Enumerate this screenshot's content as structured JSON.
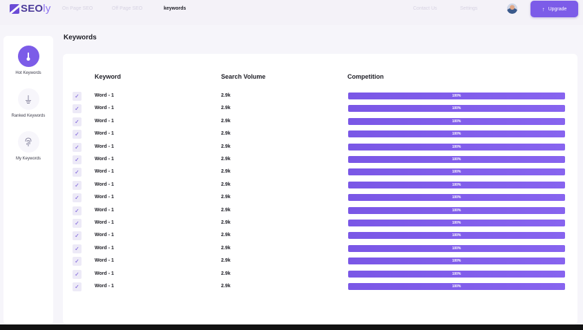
{
  "app": {
    "logo_main": "SEO",
    "logo_accent": "ly",
    "accent_color": "#7c5ce8"
  },
  "nav": {
    "links": [
      {
        "label": "On Page SEO",
        "active": false
      },
      {
        "label": "Off Page SEO",
        "active": false
      },
      {
        "label": "keywords",
        "active": true
      },
      {
        "label": "Contact Us",
        "active": false
      },
      {
        "label": "Settings",
        "active": false
      }
    ],
    "upgrade_label": "Upgrade",
    "upgrade_icon": "arrow-up-icon",
    "avatar_icon": "user-avatar"
  },
  "sidebar": {
    "items": [
      {
        "label": "Hot Keywords",
        "icon": "thermometer-icon",
        "active": true
      },
      {
        "label": "Ranked Keywords",
        "icon": "ranking-icon",
        "active": false
      },
      {
        "label": "My Keywords",
        "icon": "fingerprint-icon",
        "active": false
      }
    ]
  },
  "main": {
    "title": "Keywords",
    "columns": [
      "Keyword",
      "Search Volume",
      "Competition"
    ],
    "rows": [
      {
        "keyword": "Word - 1",
        "volume": "2.9k",
        "competition": 1.0,
        "competition_label": "100%",
        "checked": true
      },
      {
        "keyword": "Word - 1",
        "volume": "2.9k",
        "competition": 1.0,
        "competition_label": "100%",
        "checked": true
      },
      {
        "keyword": "Word - 1",
        "volume": "2.9k",
        "competition": 1.0,
        "competition_label": "100%",
        "checked": true
      },
      {
        "keyword": "Word - 1",
        "volume": "2.9k",
        "competition": 1.0,
        "competition_label": "100%",
        "checked": true
      },
      {
        "keyword": "Word - 1",
        "volume": "2.9k",
        "competition": 1.0,
        "competition_label": "100%",
        "checked": true
      },
      {
        "keyword": "Word - 1",
        "volume": "2.9k",
        "competition": 1.0,
        "competition_label": "100%",
        "checked": true
      },
      {
        "keyword": "Word - 1",
        "volume": "2.9k",
        "competition": 1.0,
        "competition_label": "100%",
        "checked": true
      },
      {
        "keyword": "Word - 1",
        "volume": "2.9k",
        "competition": 1.0,
        "competition_label": "100%",
        "checked": true
      },
      {
        "keyword": "Word - 1",
        "volume": "2.9k",
        "competition": 1.0,
        "competition_label": "100%",
        "checked": true
      },
      {
        "keyword": "Word - 1",
        "volume": "2.9k",
        "competition": 1.0,
        "competition_label": "100%",
        "checked": true
      },
      {
        "keyword": "Word - 1",
        "volume": "2.9k",
        "competition": 1.0,
        "competition_label": "100%",
        "checked": true
      },
      {
        "keyword": "Word - 1",
        "volume": "2.9k",
        "competition": 1.0,
        "competition_label": "100%",
        "checked": true
      },
      {
        "keyword": "Word - 1",
        "volume": "2.9k",
        "competition": 1.0,
        "competition_label": "100%",
        "checked": true
      },
      {
        "keyword": "Word - 1",
        "volume": "2.9k",
        "competition": 1.0,
        "competition_label": "100%",
        "checked": true
      },
      {
        "keyword": "Word - 1",
        "volume": "2.9k",
        "competition": 1.0,
        "competition_label": "100%",
        "checked": true
      },
      {
        "keyword": "Word - 1",
        "volume": "2.9k",
        "competition": 1.0,
        "competition_label": "100%",
        "checked": true
      }
    ]
  }
}
